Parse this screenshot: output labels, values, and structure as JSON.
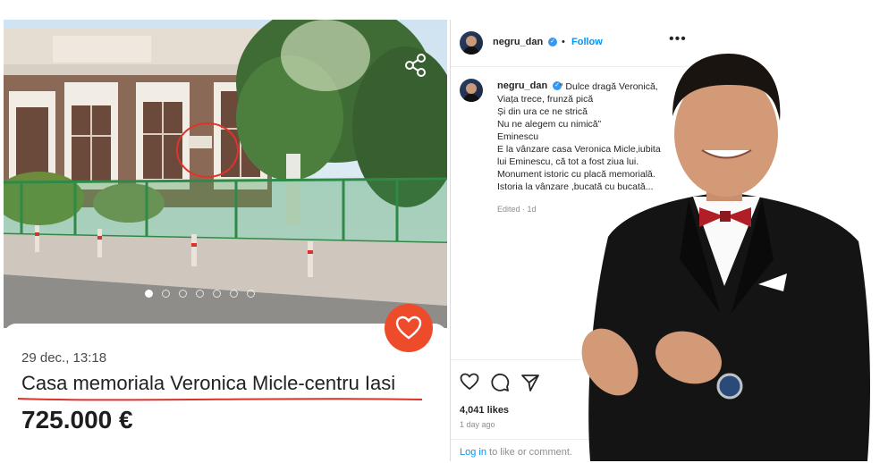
{
  "listing": {
    "date": "29 dec., 13:18",
    "title": "Casa memoriala Veronica Micle-centru Iasi",
    "price": "725.000 €",
    "photo_count": 7,
    "active_photo": 1,
    "icons": {
      "share": "share-icon",
      "favorite": "heart-icon"
    },
    "colors": {
      "favorite_bg": "#ee4b2b",
      "underline": "#d9342b"
    }
  },
  "instagram": {
    "username": "negru_dan",
    "separator": "•",
    "follow_label": "Follow",
    "more_label": "•••",
    "caption_lines": [
      "“ Dulce dragă Veronică,",
      "Viața trece, frunză pică",
      "Și din ura ce ne strică",
      "Nu ne alegem cu nimică”",
      "Eminescu",
      "E la vânzare casa Veronica Micle,iubita",
      "lui Eminescu, că tot a fost ziua lui.",
      "Monument istoric cu placă memorială.",
      "Istoria la vânzare ,bucată cu bucată..."
    ],
    "edited": "Edited · 1d",
    "likes": "4,041 likes",
    "time_ago": "1 day ago",
    "login_link": "Log in",
    "login_rest": " to like or comment.",
    "icons": [
      "heart-icon",
      "comment-icon",
      "send-icon"
    ],
    "colors": {
      "link": "#0095f6",
      "verified": "#3897f0"
    }
  }
}
